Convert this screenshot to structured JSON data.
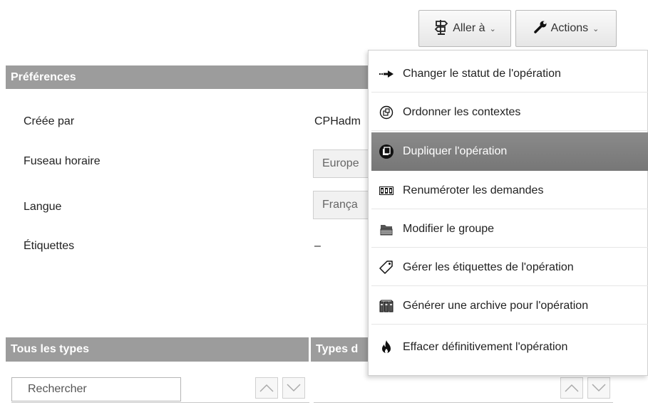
{
  "toolbar": {
    "goto_label": "Aller à",
    "actions_label": "Actions",
    "caret": "⌄"
  },
  "preferences": {
    "header": "Préférences",
    "created_by_label": "Créée par",
    "created_by_value": "CPHadm",
    "timezone_label": "Fuseau horaire",
    "timezone_value": "Europe",
    "language_label": "Langue",
    "language_value": "França",
    "tags_label": "Étiquettes",
    "tags_value": "–"
  },
  "types": {
    "all_header": "Tous les types",
    "selected_header": "Types d",
    "search_placeholder": "Rechercher"
  },
  "menu": {
    "items": [
      {
        "label": "Changer le statut de l'opération",
        "icon": "arrow-right-icon"
      },
      {
        "label": "Ordonner les contextes",
        "icon": "order-contexts-icon"
      },
      {
        "label": "Dupliquer l'opération",
        "icon": "duplicate-icon"
      },
      {
        "label": "Renuméroter les demandes",
        "icon": "renumber-icon"
      },
      {
        "label": "Modifier le groupe",
        "icon": "group-tray-icon"
      },
      {
        "label": "Gérer les étiquettes de l'opération",
        "icon": "tag-icon"
      },
      {
        "label": "Générer une archive pour l'opération",
        "icon": "archive-icon"
      },
      {
        "label": "Effacer définitivement l'opération",
        "icon": "flame-icon"
      }
    ],
    "active_index": 2
  }
}
